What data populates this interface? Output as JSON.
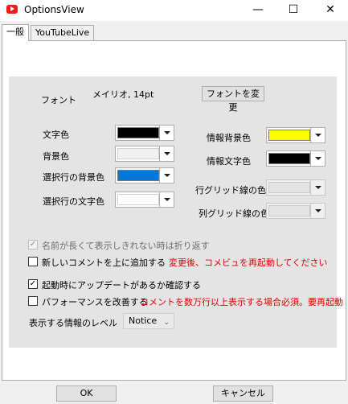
{
  "window": {
    "title": "OptionsView",
    "minimize_glyph": "—",
    "maximize_glyph": "☐",
    "close_glyph": "✕"
  },
  "tabs": [
    {
      "label": "一般"
    },
    {
      "label": "YouTubeLive"
    }
  ],
  "font": {
    "label": "フォント",
    "value": "メイリオ, 14pt",
    "change_button": "フォントを変更"
  },
  "colors": {
    "text_color": {
      "label": "文字色",
      "value": "#000000"
    },
    "background_color": {
      "label": "背景色",
      "value": "#f0f0f0"
    },
    "selected_row_bg": {
      "label": "選択行の背景色",
      "value": "#0078d7"
    },
    "selected_row_text": {
      "label": "選択行の文字色",
      "value": "#ffffff"
    },
    "info_bg": {
      "label": "情報背景色",
      "value": "#ffff00"
    },
    "info_text": {
      "label": "情報文字色",
      "value": "#000000"
    },
    "row_grid": {
      "label": "行グリッド線の色",
      "value": "#e3e3e3"
    },
    "col_grid": {
      "label": "列グリッド線の色",
      "value": "#e3e3e3"
    }
  },
  "options": {
    "wrap_long_names": {
      "label": "名前が長くて表示しきれない時は折り返す",
      "checked": true,
      "disabled": true
    },
    "new_comment_top": {
      "label": "新しいコメントを上に追加する",
      "checked": false,
      "note": "変更後、コメビュを再起動してください"
    },
    "check_update": {
      "label": "起動時にアップデートがあるか確認する",
      "checked": true
    },
    "improve_perf": {
      "label": "パフォーマンスを改善する",
      "checked": false,
      "note": "コメントを数万行以上表示する場合必須。要再起動"
    },
    "check_glyph": "✓"
  },
  "log_level": {
    "label": "表示する情報のレベル",
    "value": "Notice",
    "arrow": "⌄"
  },
  "footer": {
    "ok": "OK",
    "cancel": "キャンセル"
  }
}
